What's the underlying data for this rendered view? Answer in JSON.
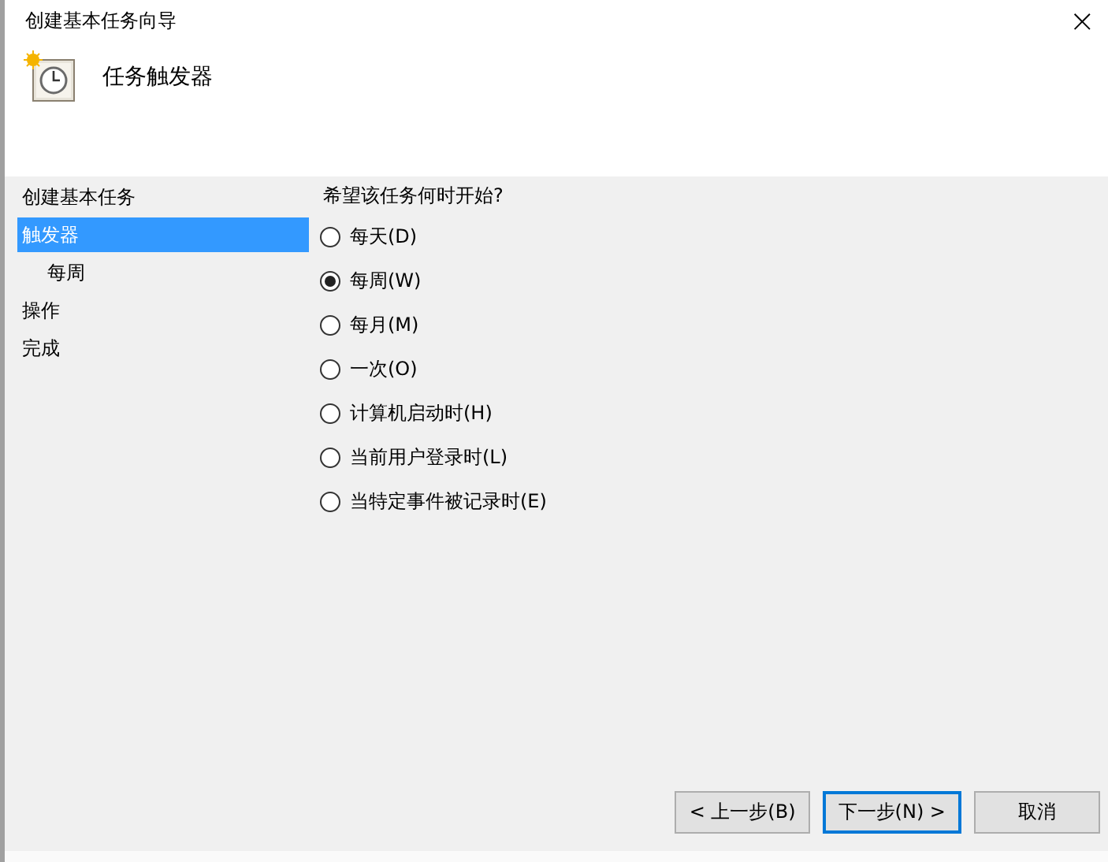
{
  "window": {
    "title": "创建基本任务向导",
    "close": "×"
  },
  "header": {
    "title": "任务触发器"
  },
  "sidebar": {
    "items": [
      {
        "label": "创建基本任务",
        "selected": false
      },
      {
        "label": "触发器",
        "selected": true,
        "children": [
          {
            "label": "每周",
            "selected": false
          }
        ]
      },
      {
        "label": "操作",
        "selected": false
      },
      {
        "label": "完成",
        "selected": false
      }
    ]
  },
  "question": "希望该任务何时开始?",
  "options": [
    {
      "label": "每天(D)",
      "selected": false
    },
    {
      "label": "每周(W)",
      "selected": true
    },
    {
      "label": "每月(M)",
      "selected": false
    },
    {
      "label": "一次(O)",
      "selected": false
    },
    {
      "label": "计算机启动时(H)",
      "selected": false
    },
    {
      "label": "当前用户登录时(L)",
      "selected": false
    },
    {
      "label": "当特定事件被记录时(E)",
      "selected": false
    }
  ],
  "buttons": [
    {
      "label": "< 上一步(B)",
      "kind": "normal"
    },
    {
      "label": "下一步(N) >",
      "kind": "default"
    },
    {
      "label": "取消",
      "kind": "normal"
    }
  ]
}
